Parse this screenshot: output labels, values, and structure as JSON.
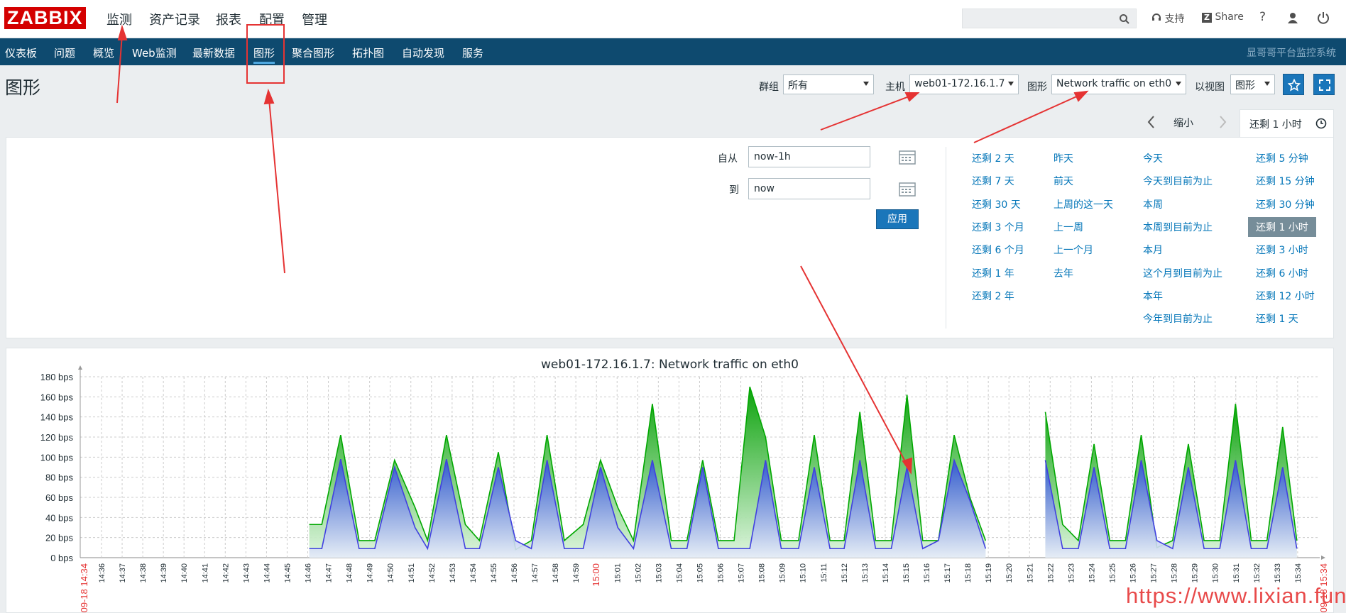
{
  "header": {
    "logo": "ZABBIX",
    "main_menu": [
      "监测",
      "资产记录",
      "报表",
      "配置",
      "管理"
    ],
    "support_label": "支持",
    "share_label": "Share",
    "help_label": "?"
  },
  "nav": {
    "items": [
      "仪表板",
      "问题",
      "概览",
      "Web监测",
      "最新数据",
      "图形",
      "聚合图形",
      "拓扑图",
      "自动发现",
      "服务"
    ],
    "active": "图形",
    "brand": "显哥哥平台监控系统"
  },
  "page": {
    "title": "图形",
    "group_label": "群组",
    "group_value": "所有",
    "host_label": "主机",
    "host_value": "web01-172.16.1.7",
    "graph_label": "图形",
    "graph_value": "Network traffic on eth0",
    "view_label": "以视图",
    "view_value": "图形"
  },
  "timebar": {
    "zoom_out": "缩小",
    "current": "还剩 1 小时"
  },
  "filter": {
    "from_label": "自从",
    "from_value": "now-1h",
    "to_label": "到",
    "to_value": "now",
    "apply": "应用",
    "quick_columns": [
      [
        "还剩 2 天",
        "还剩 7 天",
        "还剩 30 天",
        "还剩 3 个月",
        "还剩 6 个月",
        "还剩 1 年",
        "还剩 2 年"
      ],
      [
        "昨天",
        "前天",
        "上周的这一天",
        "上一周",
        "上一个月",
        "去年"
      ],
      [
        "今天",
        "今天到目前为止",
        "本周",
        "本周到目前为止",
        "本月",
        "这个月到目前为止",
        "本年",
        "今年到目前为止"
      ],
      [
        "还剩 5 分钟",
        "还剩 15 分钟",
        "还剩 30 分钟",
        "还剩 1 小时",
        "还剩 3 小时",
        "还剩 6 小时",
        "还剩 12 小时",
        "还剩 1 天"
      ]
    ],
    "active_quick": "还剩 1 小时"
  },
  "watermark": "https://www.lixian.fun",
  "chart_data": {
    "type": "area",
    "title": "web01-172.16.1.7: Network traffic on eth0",
    "y_unit": "bps",
    "ylim": [
      0,
      180
    ],
    "y_ticks": [
      "0 bps",
      "20 bps",
      "40 bps",
      "60 bps",
      "80 bps",
      "100 bps",
      "120 bps",
      "140 bps",
      "160 bps",
      "180 bps"
    ],
    "x_start_label": "09-18 14:34",
    "x_end_label": "09-18 15:34",
    "x_ticks": [
      "14:36",
      "14:37",
      "14:38",
      "14:39",
      "14:40",
      "14:41",
      "14:42",
      "14:43",
      "14:44",
      "14:45",
      "14:46",
      "14:47",
      "14:48",
      "14:49",
      "14:50",
      "14:51",
      "14:52",
      "14:53",
      "14:54",
      "14:55",
      "14:56",
      "14:57",
      "14:58",
      "14:59",
      "15:00",
      "15:01",
      "15:02",
      "15:03",
      "15:04",
      "15:05",
      "15:06",
      "15:07",
      "15:08",
      "15:09",
      "15:10",
      "15:11",
      "15:12",
      "15:13",
      "15:14",
      "15:15",
      "15:16",
      "15:17",
      "15:18",
      "15:19",
      "15:20",
      "15:21",
      "15:22",
      "15:23",
      "15:24",
      "15:25",
      "15:26",
      "15:27",
      "15:28",
      "15:29",
      "15:30",
      "15:31",
      "15:32",
      "15:33",
      "15:34"
    ],
    "highlight_ticks": [
      "15:00"
    ],
    "grid": true,
    "series": [
      {
        "color": "#00a800",
        "segments": [
          [
            [
              14.57,
              33
            ],
            [
              15.37,
              33
            ],
            [
              16.57,
              122
            ],
            [
              17.74,
              17
            ],
            [
              18.74,
              17
            ],
            [
              20.0,
              97
            ],
            [
              21.3,
              50
            ],
            [
              22.1,
              17
            ],
            [
              23.3,
              122
            ],
            [
              24.5,
              33
            ],
            [
              25.4,
              17
            ],
            [
              26.6,
              105
            ],
            [
              27.7,
              8
            ],
            [
              28.7,
              17
            ],
            [
              29.7,
              122
            ],
            [
              30.8,
              17
            ],
            [
              32.0,
              33
            ],
            [
              33.1,
              97
            ],
            [
              34.2,
              50
            ],
            [
              35.2,
              17
            ],
            [
              36.4,
              153
            ],
            [
              37.6,
              17
            ],
            [
              38.6,
              17
            ],
            [
              39.6,
              97
            ],
            [
              40.6,
              17
            ],
            [
              41.6,
              17
            ],
            [
              42.6,
              170
            ],
            [
              43.6,
              120
            ],
            [
              44.6,
              17
            ],
            [
              45.7,
              17
            ],
            [
              46.7,
              122
            ],
            [
              47.7,
              17
            ],
            [
              48.6,
              17
            ],
            [
              49.6,
              145
            ],
            [
              50.6,
              17
            ],
            [
              51.6,
              17
            ],
            [
              52.6,
              162
            ],
            [
              53.6,
              17
            ],
            [
              54.6,
              17
            ],
            [
              55.6,
              122
            ],
            [
              56.6,
              60
            ],
            [
              57.6,
              17
            ]
          ],
          [
            [
              61.4,
              145
            ],
            [
              62.5,
              33
            ],
            [
              63.5,
              17
            ],
            [
              64.5,
              113
            ],
            [
              65.5,
              17
            ],
            [
              66.5,
              17
            ],
            [
              67.5,
              122
            ],
            [
              68.5,
              10
            ],
            [
              69.5,
              17
            ],
            [
              70.5,
              113
            ],
            [
              71.5,
              17
            ],
            [
              72.5,
              17
            ],
            [
              73.5,
              153
            ],
            [
              74.5,
              17
            ],
            [
              75.5,
              17
            ],
            [
              76.5,
              130
            ],
            [
              77.4,
              17
            ]
          ]
        ]
      },
      {
        "color": "#4040e0",
        "segments": [
          [
            [
              14.57,
              9
            ],
            [
              15.37,
              9
            ],
            [
              16.57,
              98
            ],
            [
              17.74,
              9
            ],
            [
              18.74,
              9
            ],
            [
              20.0,
              90
            ],
            [
              21.3,
              30
            ],
            [
              22.1,
              9
            ],
            [
              23.3,
              98
            ],
            [
              24.5,
              9
            ],
            [
              25.4,
              9
            ],
            [
              26.6,
              90
            ],
            [
              27.7,
              17
            ],
            [
              28.7,
              9
            ],
            [
              29.7,
              97
            ],
            [
              30.8,
              9
            ],
            [
              32.0,
              9
            ],
            [
              33.1,
              90
            ],
            [
              34.2,
              30
            ],
            [
              35.2,
              9
            ],
            [
              36.4,
              97
            ],
            [
              37.6,
              9
            ],
            [
              38.6,
              9
            ],
            [
              39.6,
              90
            ],
            [
              40.6,
              9
            ],
            [
              41.6,
              9
            ],
            [
              42.6,
              9
            ],
            [
              43.6,
              97
            ],
            [
              44.6,
              9
            ],
            [
              45.7,
              9
            ],
            [
              46.7,
              90
            ],
            [
              47.7,
              9
            ],
            [
              48.6,
              9
            ],
            [
              49.6,
              97
            ],
            [
              50.6,
              9
            ],
            [
              51.6,
              9
            ],
            [
              52.6,
              90
            ],
            [
              53.6,
              9
            ],
            [
              54.6,
              17
            ],
            [
              55.6,
              97
            ],
            [
              56.6,
              57
            ],
            [
              57.6,
              9
            ]
          ],
          [
            [
              61.4,
              97
            ],
            [
              62.5,
              9
            ],
            [
              63.5,
              9
            ],
            [
              64.5,
              90
            ],
            [
              65.5,
              9
            ],
            [
              66.5,
              9
            ],
            [
              67.5,
              97
            ],
            [
              68.5,
              17
            ],
            [
              69.5,
              9
            ],
            [
              70.5,
              90
            ],
            [
              71.5,
              9
            ],
            [
              72.5,
              9
            ],
            [
              73.5,
              97
            ],
            [
              74.5,
              9
            ],
            [
              75.5,
              9
            ],
            [
              76.5,
              90
            ],
            [
              77.4,
              9
            ]
          ]
        ]
      }
    ]
  }
}
